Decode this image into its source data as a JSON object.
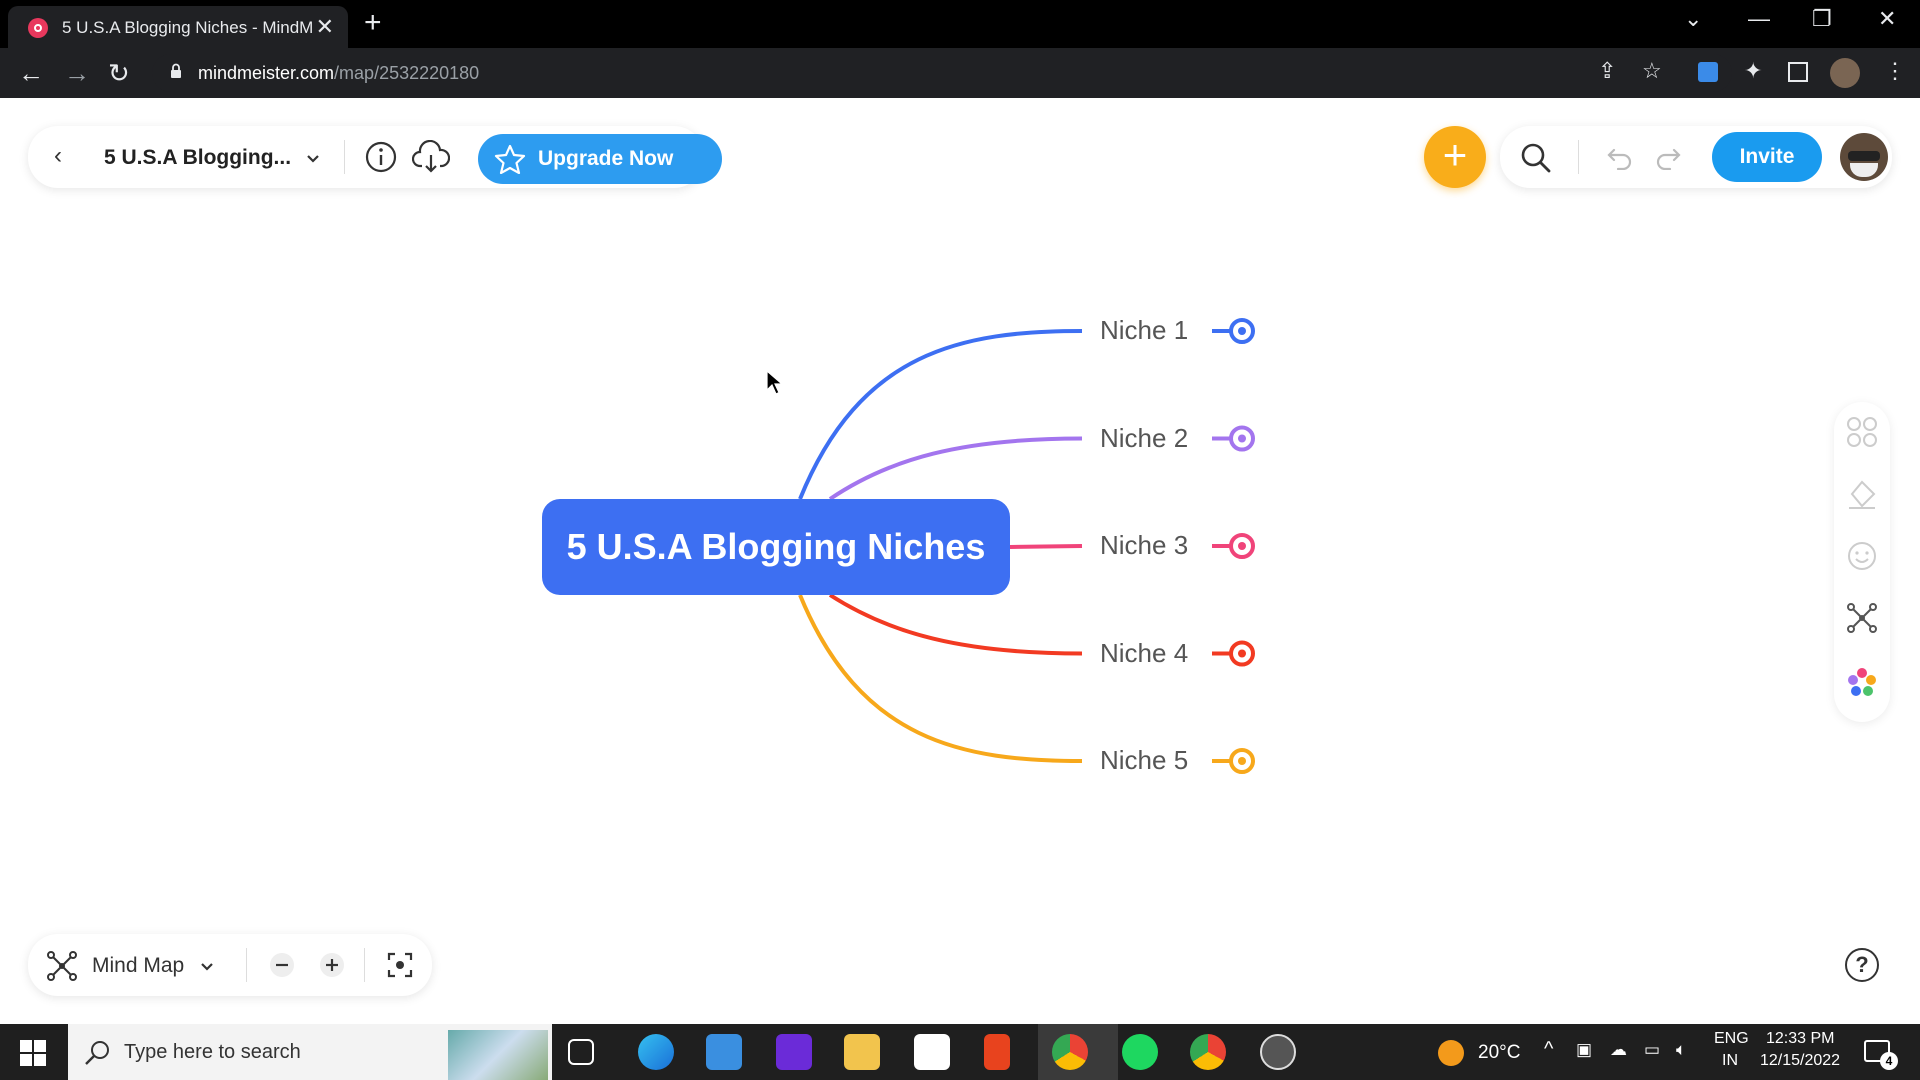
{
  "browser": {
    "tab_title": "5 U.S.A Blogging Niches - MindM",
    "url_domain": "mindmeister.com",
    "url_path": "/map/2532220180"
  },
  "app": {
    "map_name": "5 U.S.A Blogging...",
    "upgrade_label": "Upgrade Now",
    "invite_label": "Invite",
    "view_mode_label": "Mind Map"
  },
  "mindmap": {
    "root": "5 U.S.A Blogging Niches",
    "branches": [
      {
        "label": "Niche 1",
        "color": "#3d6ff2"
      },
      {
        "label": "Niche 2",
        "color": "#a375ee"
      },
      {
        "label": "Niche 3",
        "color": "#f0447a"
      },
      {
        "label": "Niche 4",
        "color": "#f23a22"
      },
      {
        "label": "Niche 5",
        "color": "#f7a81b"
      }
    ]
  },
  "taskbar": {
    "search_placeholder": "Type here to search",
    "weather": "20°C",
    "lang_1": "ENG",
    "lang_2": "IN",
    "time": "12:33 PM",
    "date": "12/15/2022",
    "notification_count": "4"
  },
  "colors": {
    "brand_blue": "#1a9bef",
    "accent_orange": "#f9ad1a"
  }
}
